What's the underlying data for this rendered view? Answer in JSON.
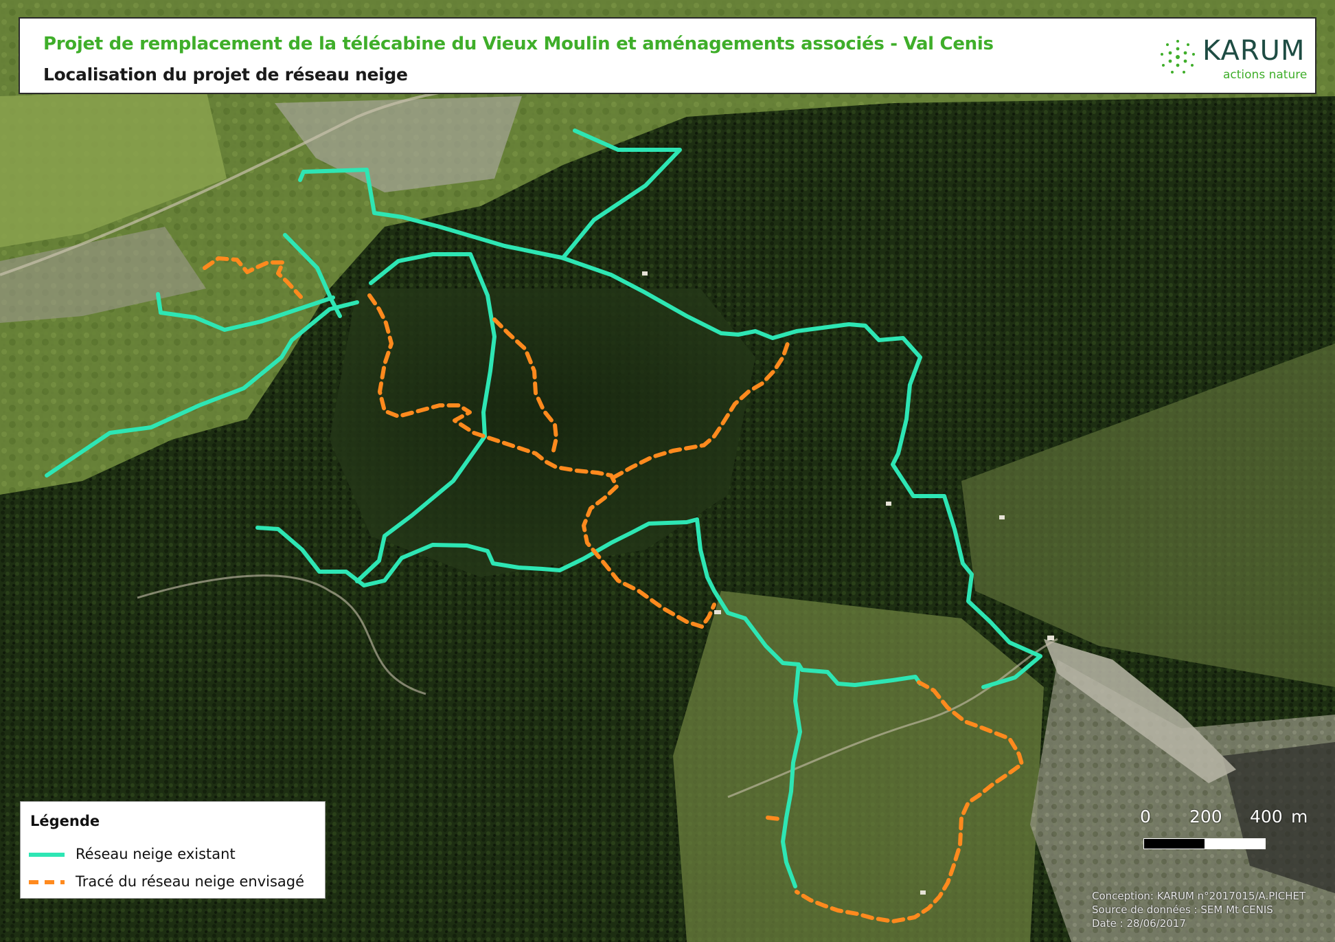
{
  "header": {
    "title": "Projet de remplacement de la télécabine du Vieux Moulin et aménagements associés - Val Cenis",
    "subtitle": "Localisation du projet de réseau neige"
  },
  "logo": {
    "name": "KARUM",
    "tagline": "actions nature",
    "icon": "dotted-flower-icon"
  },
  "legend": {
    "title": "Légende",
    "items": [
      {
        "label": "Réseau neige existant",
        "color": "#2ee6b4",
        "style": "solid"
      },
      {
        "label": "Tracé du réseau neige envisagé",
        "color": "#ff8a1e",
        "style": "dashed"
      }
    ]
  },
  "scale": {
    "labels": [
      "0",
      "200",
      "400",
      "m"
    ]
  },
  "credits": [
    "Conception: KARUM n°2017015/A.PICHET",
    "Source de données : SEM Mt CENIS",
    "Date : 28/06/2017"
  ],
  "colors": {
    "existing_network": "#2ee6b4",
    "planned_network": "#ff8a1e",
    "title_green": "#3fae2a"
  }
}
